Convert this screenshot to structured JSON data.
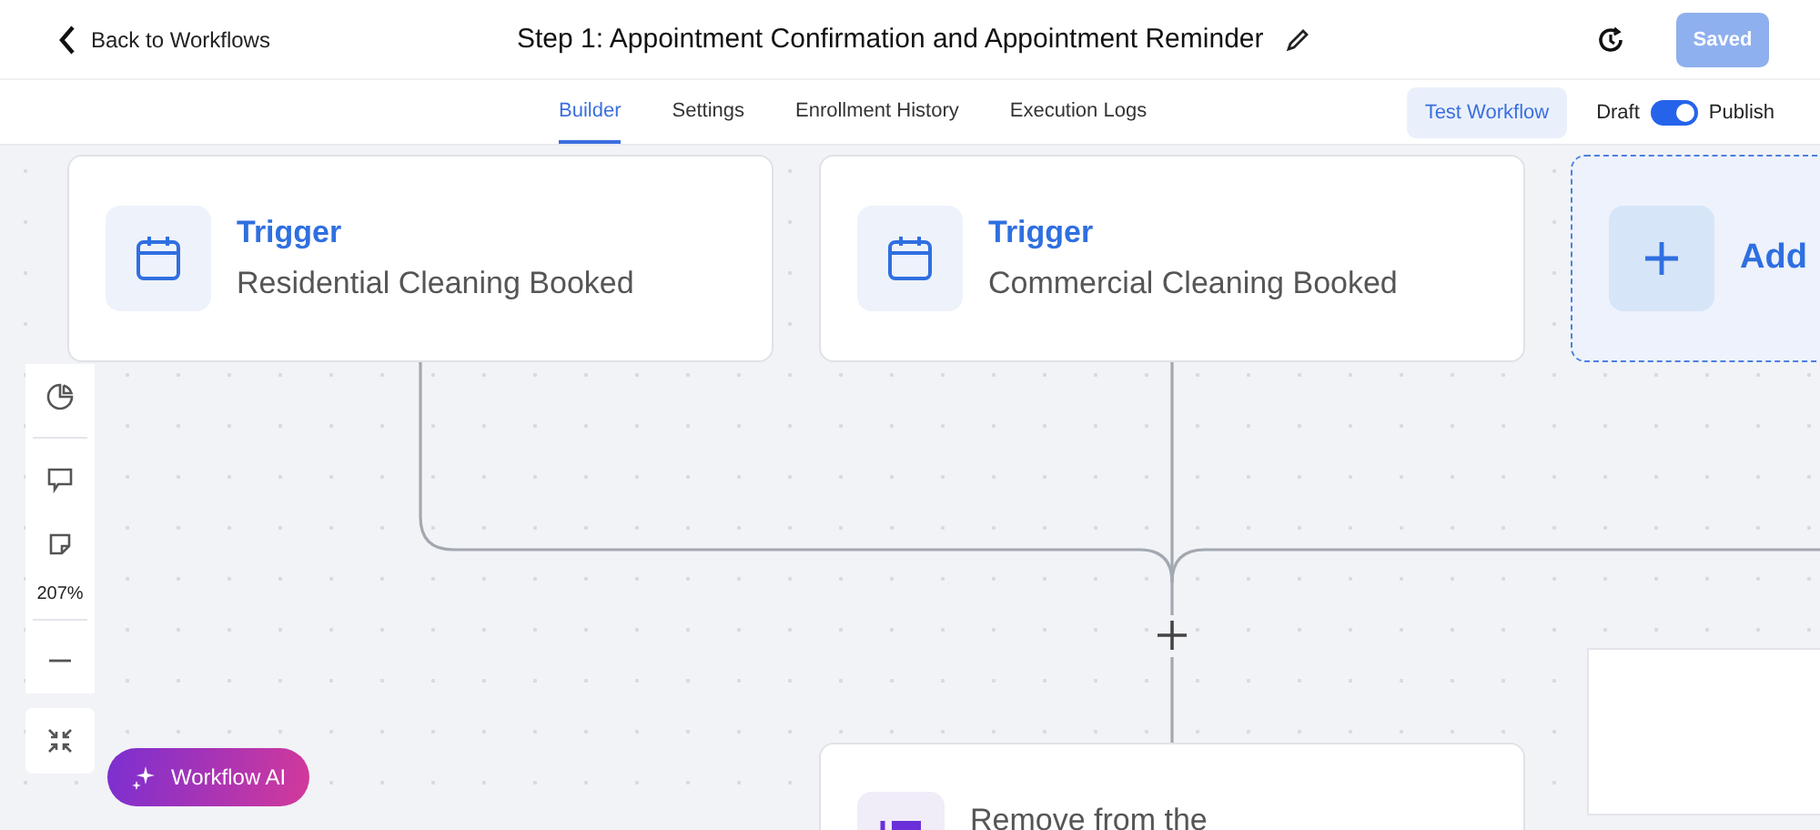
{
  "header": {
    "back_link": "Back to Workflows",
    "title": "Step 1: Appointment Confirmation and Appointment Reminder",
    "save_button": "Saved"
  },
  "tabs": [
    {
      "label": "Builder",
      "selected": true
    },
    {
      "label": "Settings",
      "selected": false
    },
    {
      "label": "Enrollment History",
      "selected": false
    },
    {
      "label": "Execution Logs",
      "selected": false
    }
  ],
  "test_button": "Test Workflow",
  "publish_toggle": {
    "off_label": "Draft",
    "on_label": "Publish",
    "on": true
  },
  "triggers": [
    {
      "label": "Trigger",
      "name": "Residential Cleaning Booked"
    },
    {
      "label": "Trigger",
      "name": "Commercial Cleaning Booked"
    }
  ],
  "add_trigger": "Add",
  "action": {
    "name": "Remove from the"
  },
  "zoom": "207%",
  "ai_button": "Workflow AI"
}
